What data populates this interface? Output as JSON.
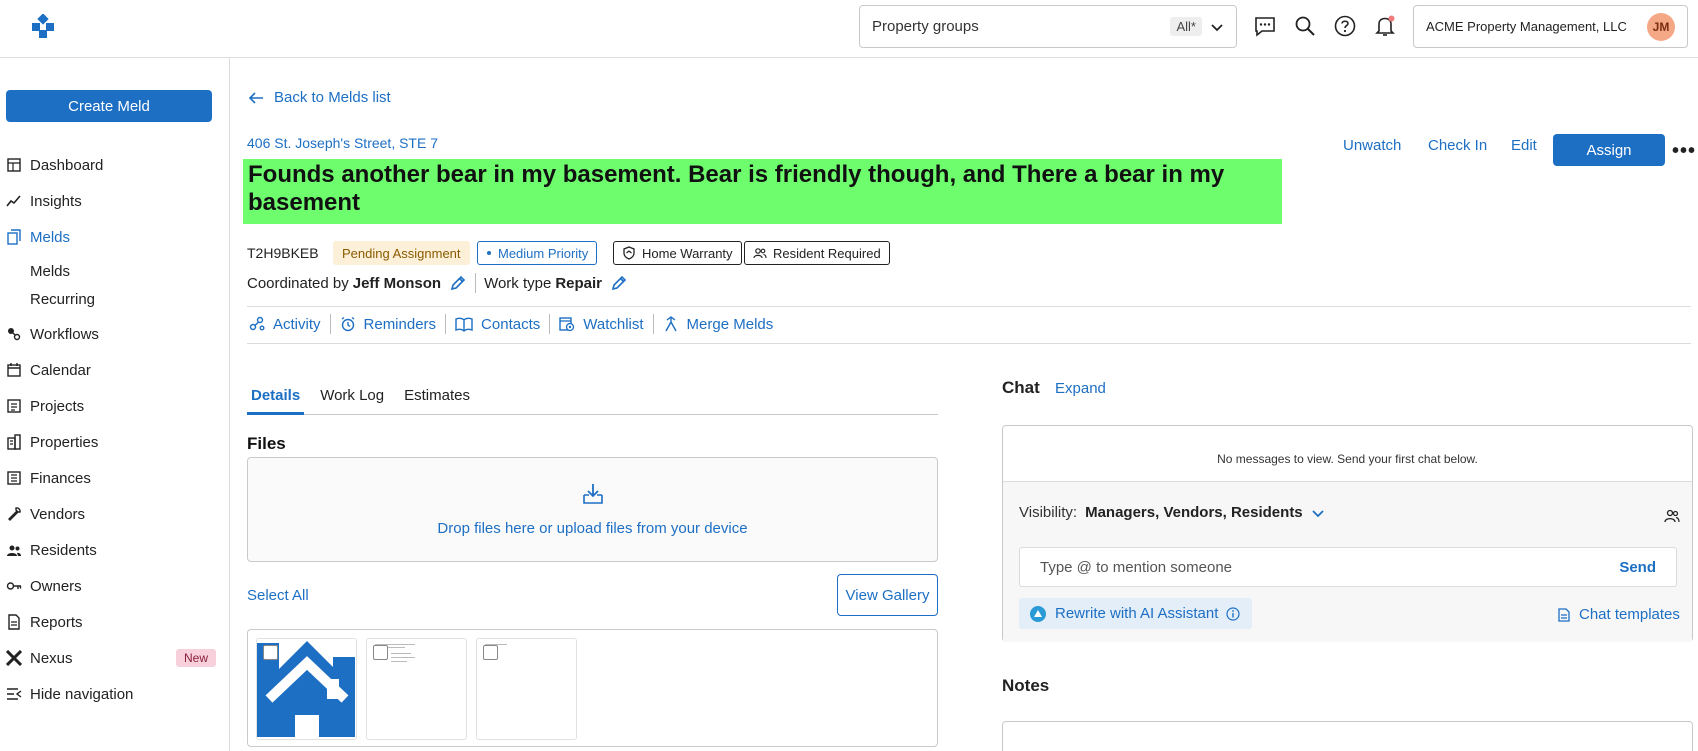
{
  "topbar": {
    "property_groups_label": "Property groups",
    "property_groups_value": "All*",
    "org_name": "ACME Property Management, LLC",
    "avatar_initials": "JM"
  },
  "sidebar": {
    "create_label": "Create Meld",
    "items": {
      "dashboard": "Dashboard",
      "insights": "Insights",
      "melds": "Melds",
      "melds_sub": "Melds",
      "recurring": "Recurring",
      "workflows": "Workflows",
      "calendar": "Calendar",
      "projects": "Projects",
      "properties": "Properties",
      "finances": "Finances",
      "vendors": "Vendors",
      "residents": "Residents",
      "owners": "Owners",
      "reports": "Reports",
      "nexus": "Nexus",
      "nexus_badge": "New",
      "hide_nav": "Hide navigation"
    }
  },
  "meld": {
    "back_label": "Back to Melds list",
    "address": "406 St. Joseph's Street, STE 7",
    "title": "Founds another bear in my basement. Bear is friendly though, and There a bear in my basement",
    "actions": {
      "unwatch": "Unwatch",
      "check_in": "Check In",
      "edit": "Edit",
      "assign": "Assign",
      "more": "•••"
    },
    "id": "T2H9BKEB",
    "badges": {
      "status": "Pending Assignment",
      "priority": "Medium Priority",
      "warranty": "Home Warranty",
      "resident": "Resident Required"
    },
    "coordinated_by_label": "Coordinated by",
    "coordinator": "Jeff Monson",
    "work_type_label": "Work type",
    "work_type": "Repair",
    "links": {
      "activity": "Activity",
      "reminders": "Reminders",
      "contacts": "Contacts",
      "watchlist": "Watchlist",
      "merge": "Merge Melds"
    }
  },
  "tabs": {
    "details": "Details",
    "work_log": "Work Log",
    "estimates": "Estimates"
  },
  "files": {
    "heading": "Files",
    "drop_text": "Drop files here or upload files from your device",
    "select_all": "Select All",
    "view_gallery": "View Gallery"
  },
  "chat": {
    "heading": "Chat",
    "expand": "Expand",
    "empty_text": "No messages to view. Send your first chat below.",
    "visibility_label": "Visibility:",
    "visibility_value": "Managers, Vendors, Residents",
    "input_placeholder": "Type @ to mention someone",
    "send": "Send",
    "ai_label": "Rewrite with AI Assistant",
    "templates": "Chat templates"
  },
  "notes": {
    "heading": "Notes"
  },
  "colors": {
    "accent": "#1d6fc4",
    "title_highlight": "#6dfd6d",
    "pending_bg": "#fdf0d8",
    "new_badge_bg": "#f7d0db"
  }
}
